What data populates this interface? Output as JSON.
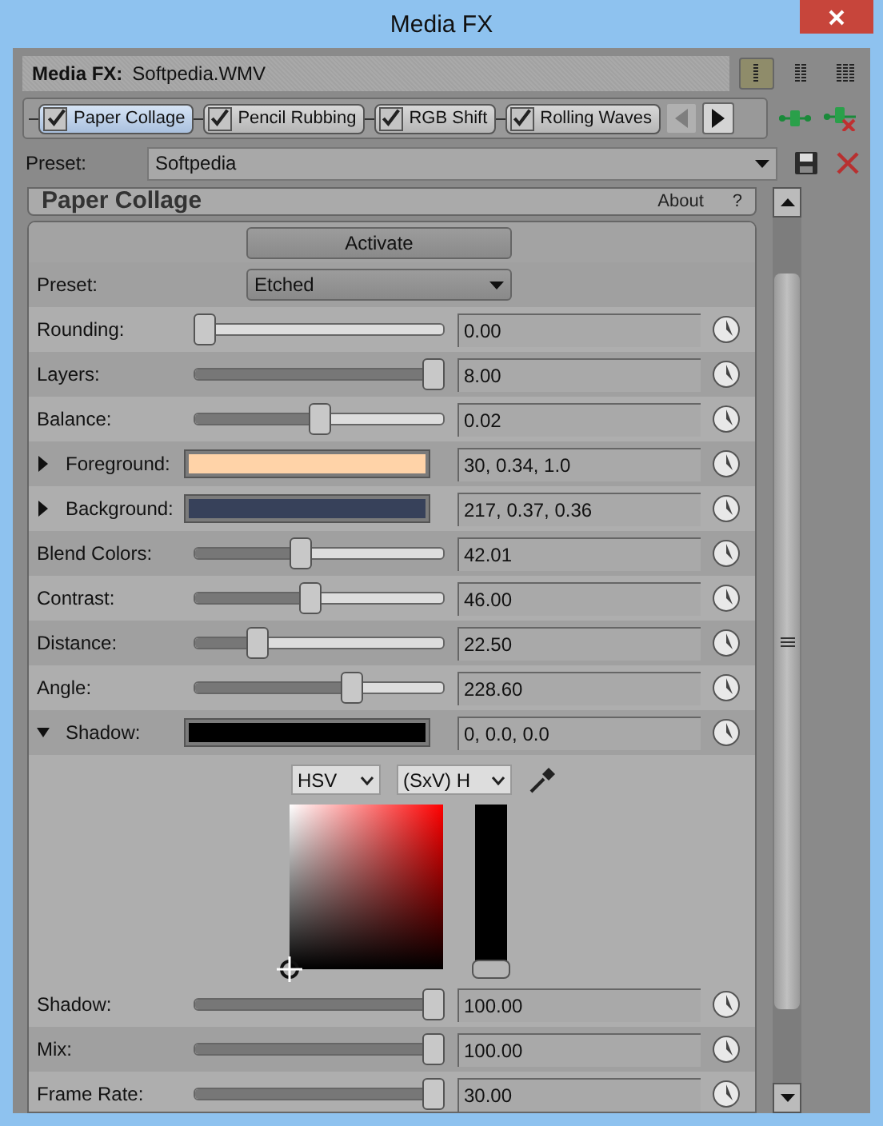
{
  "window": {
    "title": "Media FX"
  },
  "media": {
    "label": "Media FX:",
    "file": "Softpedia.WMV"
  },
  "view_modes": [
    {
      "selected": true
    },
    {
      "selected": false
    },
    {
      "selected": false
    }
  ],
  "chain": [
    {
      "label": "Paper Collage",
      "checked": true,
      "selected": true
    },
    {
      "label": "Pencil Rubbing",
      "checked": true,
      "selected": false
    },
    {
      "label": "RGB Shift",
      "checked": true,
      "selected": false
    },
    {
      "label": "Rolling Waves",
      "checked": true,
      "selected": false
    }
  ],
  "chain_nav": [
    {
      "disabled": true
    },
    {
      "disabled": false
    }
  ],
  "preset": {
    "label": "Preset:",
    "value": "Softpedia"
  },
  "plugin": {
    "title": "Paper Collage",
    "about": "About",
    "help": "?",
    "activate": "Activate"
  },
  "rows": [
    {
      "kind": "dropdown",
      "label": "Preset:",
      "value": "Etched"
    },
    {
      "kind": "slider",
      "label": "Rounding:",
      "level": 0,
      "value": "0.00"
    },
    {
      "kind": "slider",
      "label": "Layers:",
      "level": 1,
      "value": "8.00"
    },
    {
      "kind": "slider",
      "label": "Balance:",
      "level": 0.5,
      "value": "0.02"
    },
    {
      "kind": "color",
      "label": "Foreground:",
      "color": "#ffd3a8",
      "expanded": false,
      "value": "30, 0.34, 1.0"
    },
    {
      "kind": "color",
      "label": "Background:",
      "color": "#37415a",
      "expanded": false,
      "value": "217, 0.37, 0.36"
    },
    {
      "kind": "slider",
      "label": "Blend Colors:",
      "level": 0.42,
      "value": "42.01"
    },
    {
      "kind": "slider",
      "label": "Contrast:",
      "level": 0.46,
      "value": "46.00"
    },
    {
      "kind": "slider",
      "label": "Distance:",
      "level": 0.23,
      "value": "22.50"
    },
    {
      "kind": "slider",
      "label": "Angle:",
      "level": 0.64,
      "value": "228.60"
    },
    {
      "kind": "color",
      "label": "Shadow:",
      "color": "#000000",
      "expanded": true,
      "value": "0, 0.0, 0.0",
      "picker": {
        "mode": "HSV",
        "axis": "(SxV) H",
        "level": 0
      }
    },
    {
      "kind": "slider",
      "label": "Shadow:",
      "level": 1,
      "value": "100.00"
    },
    {
      "kind": "slider",
      "label": "Mix:",
      "level": 1,
      "value": "100.00"
    },
    {
      "kind": "slider",
      "label": "Frame Rate:",
      "level": 1,
      "value": "30.00"
    }
  ]
}
